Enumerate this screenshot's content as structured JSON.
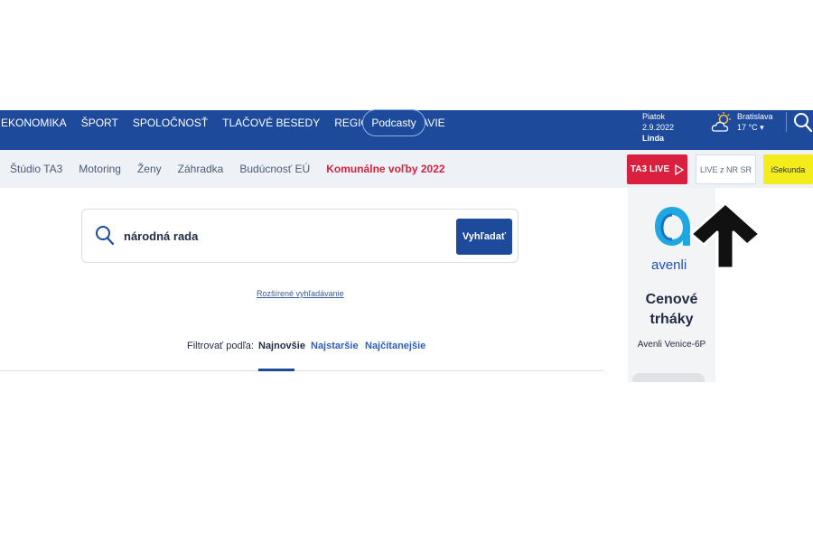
{
  "topnav": {
    "items": [
      {
        "label": "EKONOMIKA"
      },
      {
        "label": "ŠPORT"
      },
      {
        "label": "SPOLOČNOSŤ"
      },
      {
        "label": "TLAČOVÉ BESEDY"
      },
      {
        "label": "REGIÓNY"
      },
      {
        "label": "ZDRAVIE"
      }
    ],
    "podcast_label": "Podcasty",
    "date": "Piatok 2.9.2022",
    "nameday": "Linda",
    "weather_city": "Bratislava",
    "weather_temp": "17 °C",
    "weather_dropdown_icon": "▾",
    "icons": {
      "weather": "partly-cloudy-icon",
      "search": "search-icon"
    }
  },
  "subnav": {
    "items": [
      {
        "label": "Štúdio TA3",
        "highlight": false
      },
      {
        "label": "Motoring",
        "highlight": false
      },
      {
        "label": "Ženy",
        "highlight": false
      },
      {
        "label": "Záhradka",
        "highlight": false
      },
      {
        "label": "Budúcnosť EÚ",
        "highlight": false
      },
      {
        "label": "Komunálne voľby 2022",
        "highlight": true
      }
    ],
    "ta3live_label": "TA3 LIVE",
    "live_nr_label": "LIVE z NR SR",
    "isekunda_label": "iSekunda"
  },
  "search": {
    "value": "národná rada",
    "button_label": "Vyhľadať",
    "advanced_link": "Rozšírené vyhľadávanie"
  },
  "filter": {
    "label": "Filtrovať podľa:",
    "tabs": [
      {
        "label": "Najnovšie",
        "active": true
      },
      {
        "label": "Najstaršie",
        "active": false
      },
      {
        "label": "Najčítanejšie",
        "active": false
      }
    ]
  },
  "ad": {
    "brand": "avenli",
    "title_line1": "Cenové",
    "title_line2": "trháky",
    "subtitle": "Avenli Venice-6P"
  },
  "colors": {
    "nav_blue": "#1d4a9a",
    "live_red": "#d9213f",
    "isekunda_yellow": "#f5ec1b",
    "highlight_red": "#d3243f"
  }
}
